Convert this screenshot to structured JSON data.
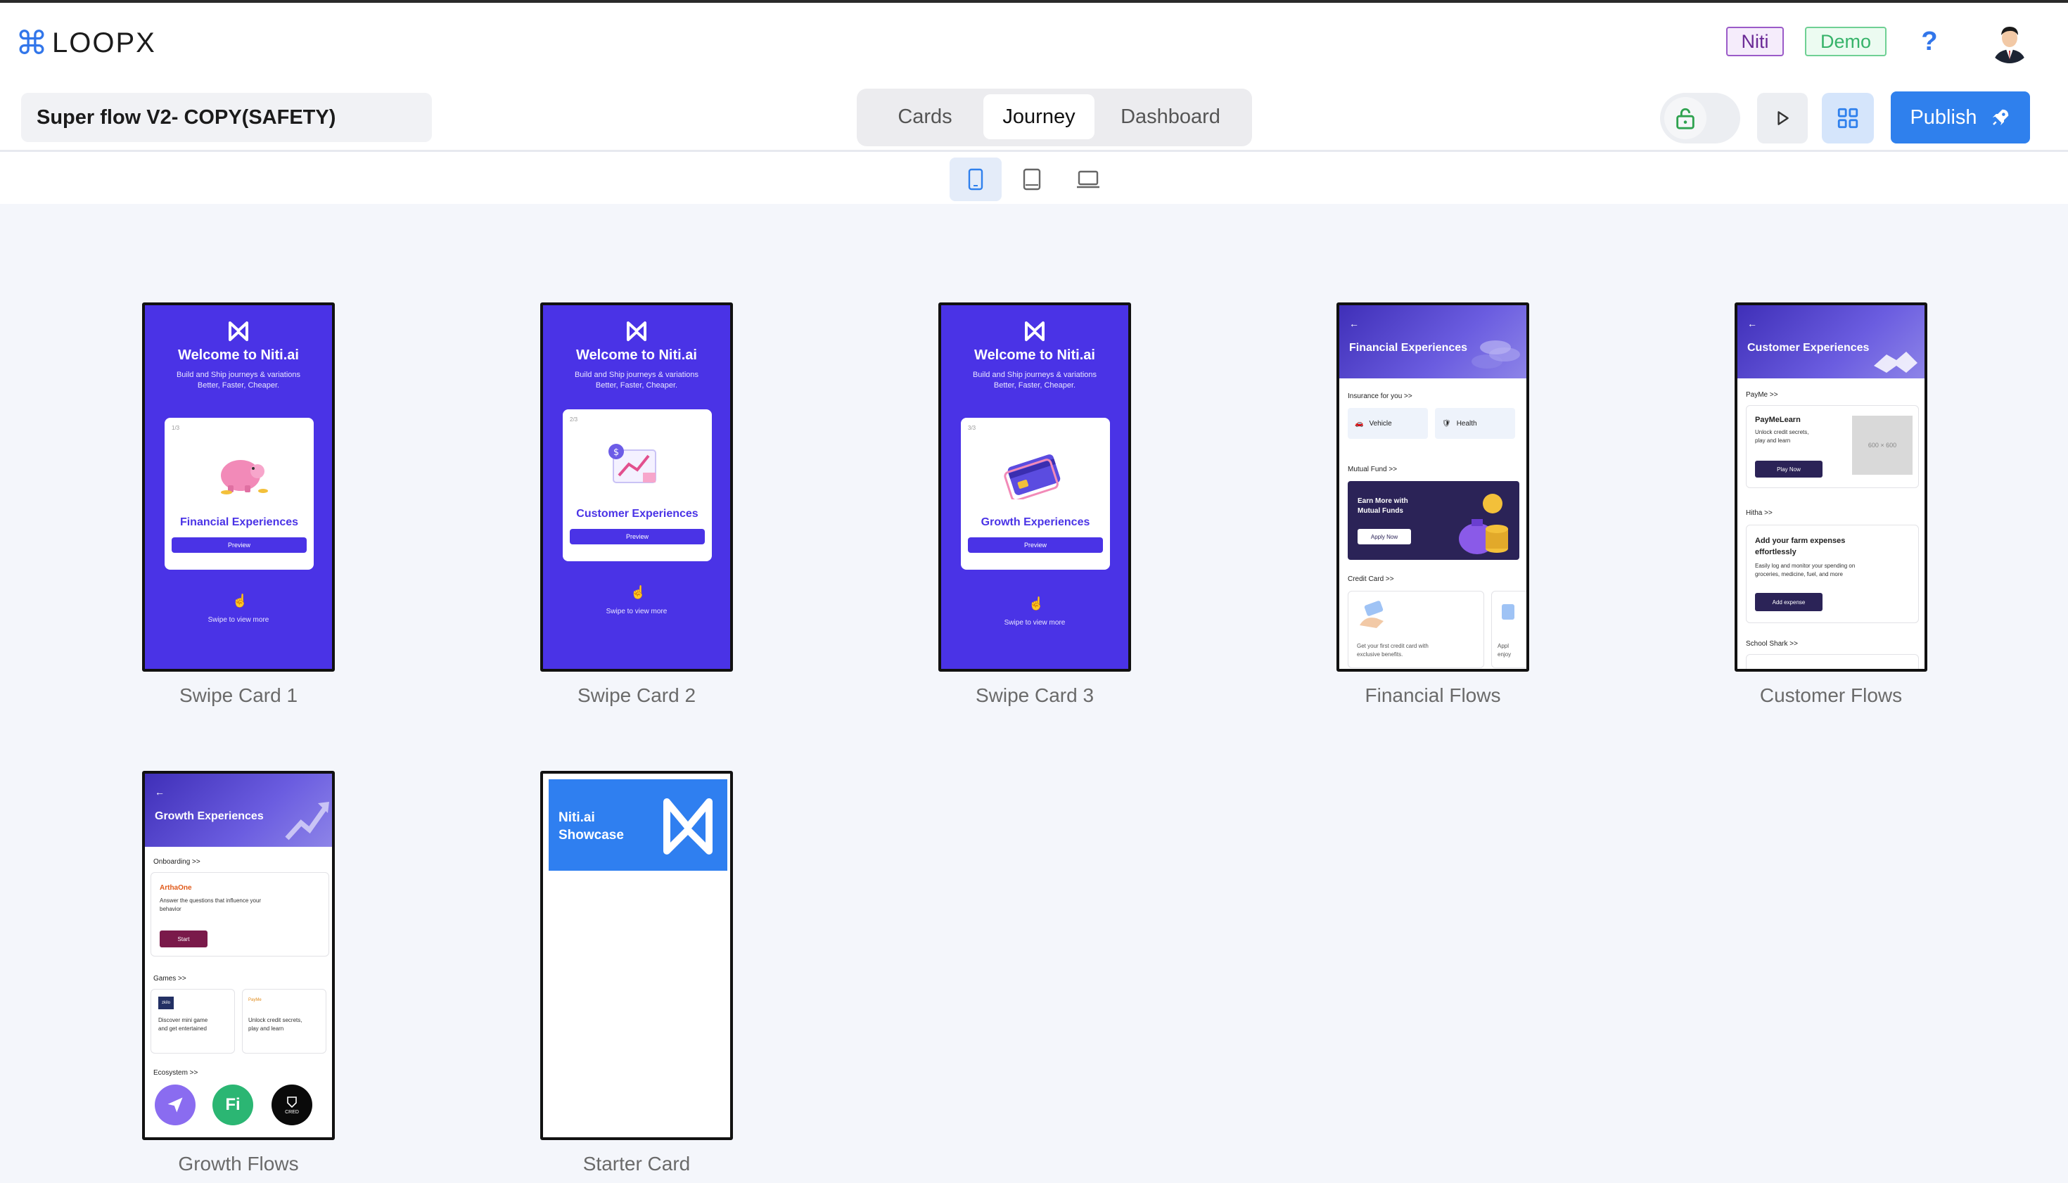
{
  "app": {
    "logo_text": "LOOPX",
    "logo_icon": "command-icon"
  },
  "header": {
    "badge_niti": "Niti",
    "badge_demo": "Demo",
    "help_icon": "?"
  },
  "project": {
    "name": "Super flow V2- COPY(SAFETY)"
  },
  "view_tabs": [
    {
      "label": "Cards",
      "active": false
    },
    {
      "label": "Journey",
      "active": true
    },
    {
      "label": "Dashboard",
      "active": false
    }
  ],
  "toolbar": {
    "publish_label": "Publish",
    "icons": [
      "unlock-icon",
      "play-icon",
      "grid-icon",
      "rocket-icon"
    ]
  },
  "devices": [
    "mobile-icon",
    "tablet-icon",
    "desktop-icon"
  ],
  "colors": {
    "brand_blue": "#2f80ed",
    "card_purple": "#4a33e6",
    "niti_purple": "#6b2a96",
    "demo_green": "#37b36a"
  },
  "cards": [
    {
      "label": "Swipe Card 1",
      "welcome": "Welcome to Niti.ai",
      "sub1": "Build and Ship journeys & variations",
      "sub2": "Better, Faster, Cheaper.",
      "index": "1/3",
      "card_title": "Financial Experiences",
      "preview": "Preview",
      "swipe": "Swipe to view more"
    },
    {
      "label": "Swipe Card 2",
      "welcome": "Welcome to Niti.ai",
      "sub1": "Build and Ship journeys & variations",
      "sub2": "Better, Faster, Cheaper.",
      "index": "2/3",
      "card_title": "Customer Experiences",
      "preview": "Preview",
      "swipe": "Swipe to view more"
    },
    {
      "label": "Swipe Card 3",
      "welcome": "Welcome to Niti.ai",
      "sub1": "Build and Ship journeys & variations",
      "sub2": "Better, Faster, Cheaper.",
      "index": "3/3",
      "card_title": "Growth Experiences",
      "preview": "Preview",
      "swipe": "Swipe to view more"
    }
  ],
  "financial_flows": {
    "label": "Financial Flows",
    "header": "Financial Experiences",
    "insurance_section": "Insurance for you >>",
    "vehicle": "Vehicle",
    "health": "Health",
    "mutual_section": "Mutual Fund >>",
    "earn_line1": "Earn More with",
    "earn_line2": "Mutual Funds",
    "apply": "Apply Now",
    "credit_section": "Credit Card >>",
    "credit_text1": "Get your first credit card with",
    "credit_text2": "exclusive benefits.",
    "credit_peek1": "Appl",
    "credit_peek2": "enjoy"
  },
  "customer_flows": {
    "label": "Customer Flows",
    "header": "Customer Experiences",
    "payme_section": "PayMe >>",
    "paymelearn_title": "PayMeLearn",
    "paymelearn_text1": "Unlock credit secrets,",
    "paymelearn_text2": "play and learn",
    "play_now": "Play Now",
    "placeholder": "600 × 600",
    "hitha_section": "Hitha >>",
    "farm_title1": "Add your farm expenses",
    "farm_title2": "effortlessly",
    "farm_text1": "Easily log and monitor your spending on",
    "farm_text2": "groceries, medicine, fuel, and more",
    "add_expense": "Add expense",
    "school_section": "School Shark >>"
  },
  "growth_flows": {
    "label": "Growth Flows",
    "header": "Growth Experiences",
    "onboarding_section": "Onboarding >>",
    "arthaone": "ArthaOne",
    "arthaone_text1": "Answer the questions that influence your",
    "arthaone_text2": "behavior",
    "start": "Start",
    "games_section": "Games >>",
    "game1_logo": "zkilo",
    "game1_text1": "Discover mini game",
    "game1_text2": "and get entertained",
    "game2_logo": "PayMe",
    "game2_text1": "Unlock credit secrets,",
    "game2_text2": "play and learn",
    "ecosystem_section": "Ecosystem >>",
    "eco3_text": "CRED"
  },
  "starter_card": {
    "label": "Starter Card",
    "line1": "Niti.ai",
    "line2": "Showcase"
  }
}
